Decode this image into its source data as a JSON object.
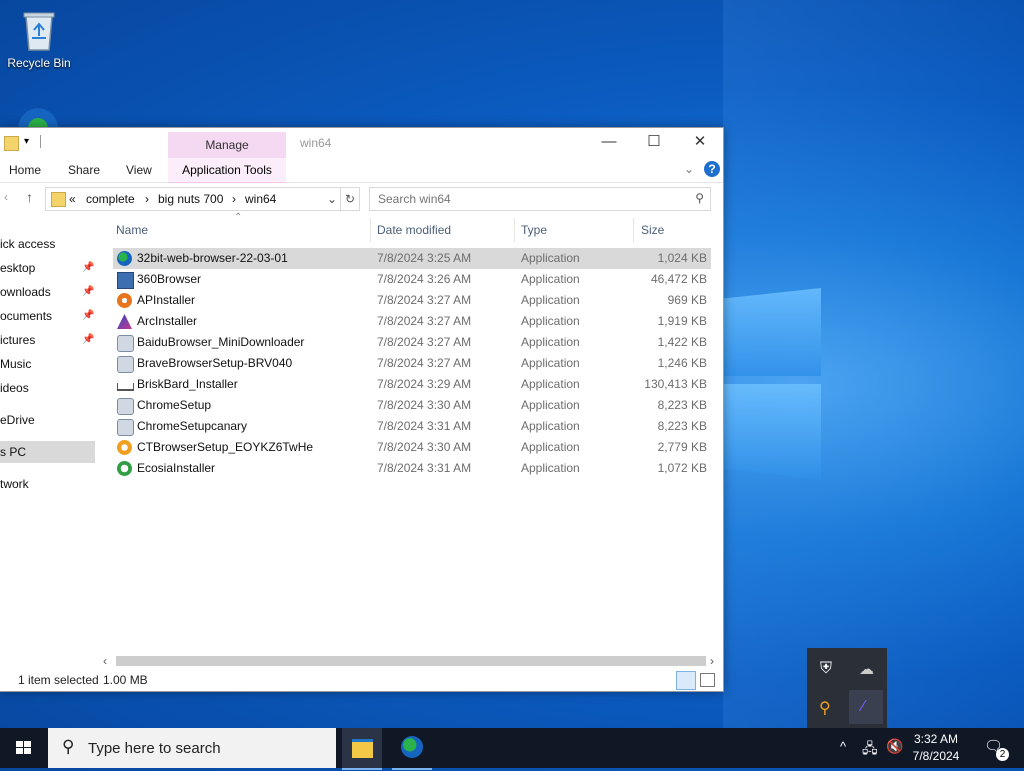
{
  "desktop": {
    "recycle_bin_label": "Recycle Bin"
  },
  "window": {
    "title": "win64",
    "manage_tab": "Manage",
    "ribbon_tabs": [
      "Home",
      "Share",
      "View"
    ],
    "application_tools": "Application Tools",
    "breadcrumb": [
      "complete",
      "big nuts 700",
      "win64"
    ],
    "breadcrumb_prefix": "«",
    "search_placeholder": "Search win64"
  },
  "nav": {
    "items": [
      {
        "label": "ick access",
        "pinned": false
      },
      {
        "label": "esktop",
        "pinned": true
      },
      {
        "label": "ownloads",
        "pinned": true
      },
      {
        "label": "ocuments",
        "pinned": true
      },
      {
        "label": "ictures",
        "pinned": true
      },
      {
        "label": "Music",
        "pinned": false
      },
      {
        "label": "ideos",
        "pinned": false
      },
      {
        "label": "eDrive",
        "pinned": false
      },
      {
        "label": "s PC",
        "pinned": false
      },
      {
        "label": "twork",
        "pinned": false
      }
    ]
  },
  "columns": {
    "name": "Name",
    "date": "Date modified",
    "type": "Type",
    "size": "Size"
  },
  "files": [
    {
      "name": "32bit-web-browser-22-03-01",
      "date": "7/8/2024 3:25 AM",
      "type": "Application",
      "size": "1,024 KB",
      "icon": "globe-icon",
      "selected": true
    },
    {
      "name": "360Browser",
      "date": "7/8/2024 3:26 AM",
      "type": "Application",
      "size": "46,472 KB",
      "icon": "installer-icon"
    },
    {
      "name": "APInstaller",
      "date": "7/8/2024 3:27 AM",
      "type": "Application",
      "size": "969 KB",
      "icon": "orange-gear-icon"
    },
    {
      "name": "ArcInstaller",
      "date": "7/8/2024 3:27 AM",
      "type": "Application",
      "size": "1,919 KB",
      "icon": "arc-icon"
    },
    {
      "name": "BaiduBrowser_MiniDownloader",
      "date": "7/8/2024 3:27 AM",
      "type": "Application",
      "size": "1,422 KB",
      "icon": "setup-icon"
    },
    {
      "name": "BraveBrowserSetup-BRV040",
      "date": "7/8/2024 3:27 AM",
      "type": "Application",
      "size": "1,246 KB",
      "icon": "setup-icon"
    },
    {
      "name": "BriskBard_Installer",
      "date": "7/8/2024 3:29 AM",
      "type": "Application",
      "size": "130,413 KB",
      "icon": "download-tray-icon"
    },
    {
      "name": "ChromeSetup",
      "date": "7/8/2024 3:30 AM",
      "type": "Application",
      "size": "8,223 KB",
      "icon": "setup-icon"
    },
    {
      "name": "ChromeSetupcanary",
      "date": "7/8/2024 3:31 AM",
      "type": "Application",
      "size": "8,223 KB",
      "icon": "setup-icon"
    },
    {
      "name": "CTBrowserSetup_EOYKZ6TwHe",
      "date": "7/8/2024 3:30 AM",
      "type": "Application",
      "size": "2,779 KB",
      "icon": "ct-icon"
    },
    {
      "name": "EcosiaInstaller",
      "date": "7/8/2024 3:31 AM",
      "type": "Application",
      "size": "1,072 KB",
      "icon": "ecosia-icon"
    }
  ],
  "status": {
    "selection": "1 item selected",
    "size": "1.00 MB"
  },
  "taskbar": {
    "search_placeholder": "Type here to search",
    "time": "3:32 AM",
    "date": "7/8/2024",
    "notification_count": "2"
  },
  "colors": {
    "accent": "#0b5bc0",
    "manage_tab": "#f5d8f2",
    "selection": "#d9d9d9"
  }
}
